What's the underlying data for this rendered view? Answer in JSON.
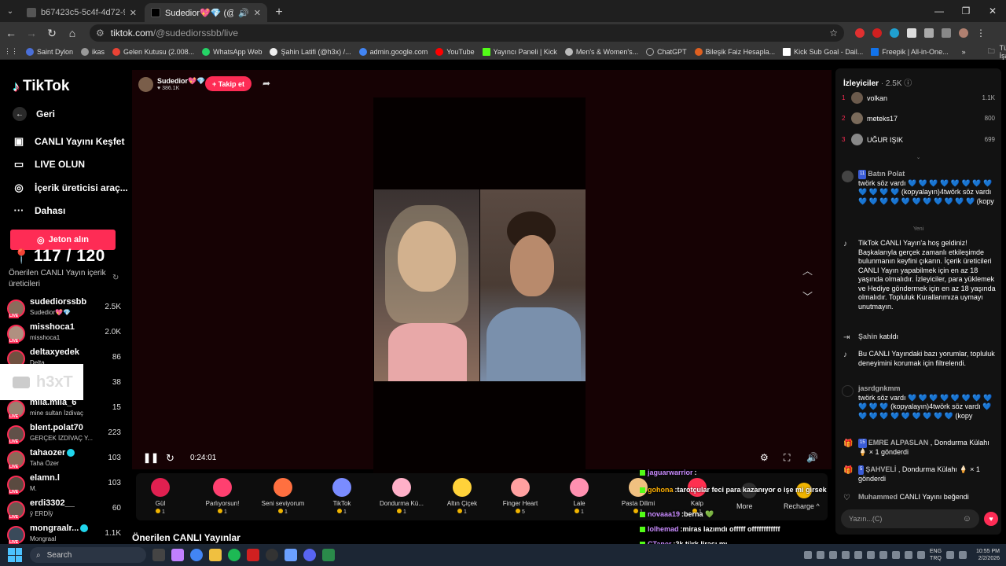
{
  "browser": {
    "tabs": [
      {
        "title": "b67423c5-5c4f-4d72-9981-187",
        "active": false
      },
      {
        "title": "Sudedior💖💎 (@sudedior",
        "active": true
      }
    ],
    "new_tab_label": "+",
    "url_domain": "tiktok.com",
    "url_path": "/@sudediorssbb/live",
    "bookmarks": [
      "Saint Dylon",
      "ikas",
      "Gelen Kutusu (2.008...",
      "WhatsApp Web",
      "Şahin Latifi (@h3x) /...",
      "admin.google.com",
      "YouTube",
      "Yayıncı Paneli | Kick",
      "Men's & Women's...",
      "ChatGPT",
      "Bileşik Faiz Hesapla...",
      "Kick Sub Goal - Dail...",
      "Freepik | All-in-One..."
    ],
    "bookmarks_overflow": "»",
    "all_bookmarks": "Tüm Yer İşaretleri"
  },
  "sidebar": {
    "logo": "TikTok",
    "nav": [
      {
        "label": "Geri",
        "icon": "←"
      },
      {
        "label": "CANLI Yayını Keşfet",
        "icon": "▣"
      },
      {
        "label": "LIVE OLUN",
        "icon": "▭"
      },
      {
        "label": "İçerik üreticisi araç...",
        "icon": "◎"
      },
      {
        "label": "Dahası",
        "icon": "···"
      }
    ],
    "coins_button": "Jeton alın",
    "score": "117 / 120",
    "suggested_header": "Önerilen CANLI Yayın içerik üreticileri",
    "creators": [
      {
        "name": "sudediorssbb",
        "sub": "Sudedior💖💎",
        "count": "2.5K"
      },
      {
        "name": "misshoca1",
        "sub": "misshoca1",
        "count": "2.0K"
      },
      {
        "name": "deltaxyedek",
        "sub": "Delta",
        "count": "86"
      },
      {
        "name": "",
        "sub": "",
        "count": "38"
      },
      {
        "name": "mila.mila_6",
        "sub": "mine sultan İzdivaç",
        "count": "15"
      },
      {
        "name": "blent.polat70",
        "sub": "GERÇEK İZDİVAÇ Y...",
        "count": "223"
      },
      {
        "name": "tahaozer",
        "sub": "Taha Özer",
        "count": "103"
      },
      {
        "name": "elamn.l",
        "sub": "M.",
        "count": "103"
      },
      {
        "name": "erdi3302__",
        "sub": "ÿ ERDİÿ",
        "count": "60"
      },
      {
        "name": "mongraalr...",
        "sub": "Mongraal",
        "count": "1.1K"
      }
    ],
    "overlay_text": "h3xT"
  },
  "stream": {
    "streamer_name": "Sudedior💖💎",
    "likes": "386.1K",
    "follow_button": "+ Takip et",
    "time": "0:24:01",
    "more_label": "More",
    "recharge_label": "Recharge",
    "gifts": [
      {
        "name": "Gül",
        "cost": "1",
        "color": "#e02050"
      },
      {
        "name": "Parlıyorsun!",
        "cost": "1",
        "color": "#ff4070"
      },
      {
        "name": "Seni seviyorum",
        "cost": "1",
        "color": "#ff7040"
      },
      {
        "name": "TikTok",
        "cost": "1",
        "color": "#7a8cff"
      },
      {
        "name": "Dondurma Kü...",
        "cost": "1",
        "color": "#ffb0c8"
      },
      {
        "name": "Altın Çiçek",
        "cost": "1",
        "color": "#ffd23a"
      },
      {
        "name": "Finger Heart",
        "cost": "5",
        "color": "#ffa0a0"
      },
      {
        "name": "Lale",
        "cost": "1",
        "color": "#ff90b0"
      },
      {
        "name": "Pasta Dilimi",
        "cost": "1",
        "color": "#f0c080"
      },
      {
        "name": "Kalp",
        "cost": "1",
        "color": "#ff3050"
      }
    ],
    "section_title": "Önerilen CANLI Yayınlar",
    "overlay_chat": [
      {
        "user": "jaguarwarrior",
        "sep": ":",
        "text": "",
        "color": "#c98cff"
      },
      {
        "user": "gohona",
        "sep": ":",
        "text": "tarotçular feci para kazanıyor o işe mi girsek",
        "color": "#ffb000"
      },
      {
        "user": "novaaa19",
        "sep": ":",
        "text": "berna 💚",
        "color": "#c98cff"
      },
      {
        "user": "lolhemad",
        "sep": ":",
        "text": "miras lazımdı offfff offffffffffff",
        "color": "#c98cff"
      },
      {
        "user": "CTaner",
        "sep": ":",
        "text": "2k türk lirası mı",
        "color": "#c98cff"
      },
      {
        "user": "fidel808",
        "sep": ":",
        "text": "nova",
        "color": "#c98cff"
      }
    ]
  },
  "chat": {
    "viewers_title": "İzleyiciler",
    "viewers_count": "· 2.5K",
    "top_viewers": [
      {
        "rank": "1",
        "name": "volkan",
        "score": "1.1K"
      },
      {
        "rank": "2",
        "name": "meteks17",
        "score": "800"
      },
      {
        "rank": "3",
        "name": "UĞUR IŞIK",
        "score": "699"
      }
    ],
    "new_label": "Yeni",
    "messages": [
      {
        "badge": "11",
        "user": "Batın Polat",
        "text": "twörk söz vardı 💙 💙 💙 💙 💙 💙 💙 💙 💙 💙 💙 💙 (kopyalayın)4twörk söz vardı 💙 💙 💙 💙 💙 💙 💙 💙 💙 💙 💙 (kopy"
      },
      {
        "badge": "",
        "user": "",
        "text": "TikTok CANLI Yayın'a hoş geldiniz! Başkalarıyla gerçek zamanlı etkileşimde bulunmanın keyfini çıkarın. İçerik üreticileri CANLI Yayın yapabilmek için en az 18 yaşında olmalıdır. İzleyiciler, para yüklemek ve Hediye göndermek için en az 18 yaşında olmalıdır. Topluluk Kurallarımıza uymayı unutmayın."
      },
      {
        "badge": "",
        "user": "Şahin",
        "text": "katıldı"
      },
      {
        "badge": "",
        "user": "",
        "text": "Bu CANLI Yayındaki bazı yorumlar, topluluk deneyimini korumak için filtrelendi."
      },
      {
        "badge": "",
        "user": "jasrdgnkmm",
        "text": "twörk söz vardı 💙 💙 💙 💙 💙 💙 💙 💙 💙 💙 💙 (kopyalayın)4twörk söz vardı 💙 💙 💙 💙 💙 💙 💙 💙 💙 💙 (kopy"
      },
      {
        "badge": "15",
        "user": "EMRE ALPASLAN",
        "text": ", Dondurma Külahı 🍦 × 1 gönderdi"
      },
      {
        "badge": "5",
        "user": "ŞAHVELİ",
        "text": ", Dondurma Külahı 🍦 × 1 gönderdi"
      },
      {
        "badge": "",
        "user": "Muhammed",
        "text": "CANLI Yayını beğendi"
      }
    ],
    "input_placeholder": "Yazın...(C)"
  },
  "taskbar": {
    "search_label": "Search",
    "lang": "ENG",
    "lang2": "TRQ",
    "time": "10:55 PM",
    "date": "2/2/2026"
  }
}
